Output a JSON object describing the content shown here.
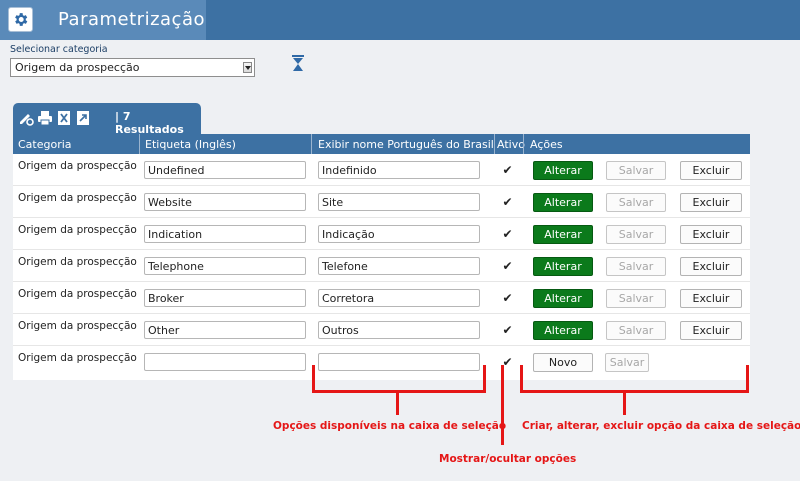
{
  "header": {
    "title": "Parametrização",
    "icon": "gear-icon"
  },
  "selector": {
    "label": "Selecionar categoria",
    "value": "Origem da prospecção"
  },
  "panel": {
    "results_label": "| 7 Resultados",
    "icons": [
      "edit-icon",
      "print-icon",
      "excel-icon",
      "export-icon"
    ]
  },
  "table": {
    "columns": [
      "Categoria",
      "Etiqueta (Inglês)",
      "Exibir nome Português do Brasil",
      "Ativo",
      "Ações"
    ],
    "rows": [
      {
        "category": "Origem da prospecção",
        "label_en": "Undefined",
        "label_pt": "Indefinido",
        "active": true
      },
      {
        "category": "Origem da prospecção",
        "label_en": "Website",
        "label_pt": "Site",
        "active": true
      },
      {
        "category": "Origem da prospecção",
        "label_en": "Indication",
        "label_pt": "Indicação",
        "active": true
      },
      {
        "category": "Origem da prospecção",
        "label_en": "Telephone",
        "label_pt": "Telefone",
        "active": true
      },
      {
        "category": "Origem da prospecção",
        "label_en": "Broker",
        "label_pt": "Corretora",
        "active": true
      },
      {
        "category": "Origem da prospecção",
        "label_en": "Other",
        "label_pt": "Outros",
        "active": true
      }
    ],
    "new_row": {
      "category": "Origem da prospecção",
      "label_en": "",
      "label_pt": "",
      "active": true
    },
    "actions": {
      "alter": "Alterar",
      "save": "Salvar",
      "delete": "Excluir",
      "new": "Novo"
    },
    "check_glyph": "✔"
  },
  "annotations": {
    "options": "Opções disponíveis na caixa de seleção",
    "show_hide": "Mostrar/ocultar opções",
    "crud": "Criar, alterar, excluir opção da caixa de seleção"
  },
  "colors": {
    "header": "#3d71a3",
    "header_tab": "#5a8ab9",
    "alter_button": "#0b7a1b",
    "annotation": "#e51616"
  }
}
